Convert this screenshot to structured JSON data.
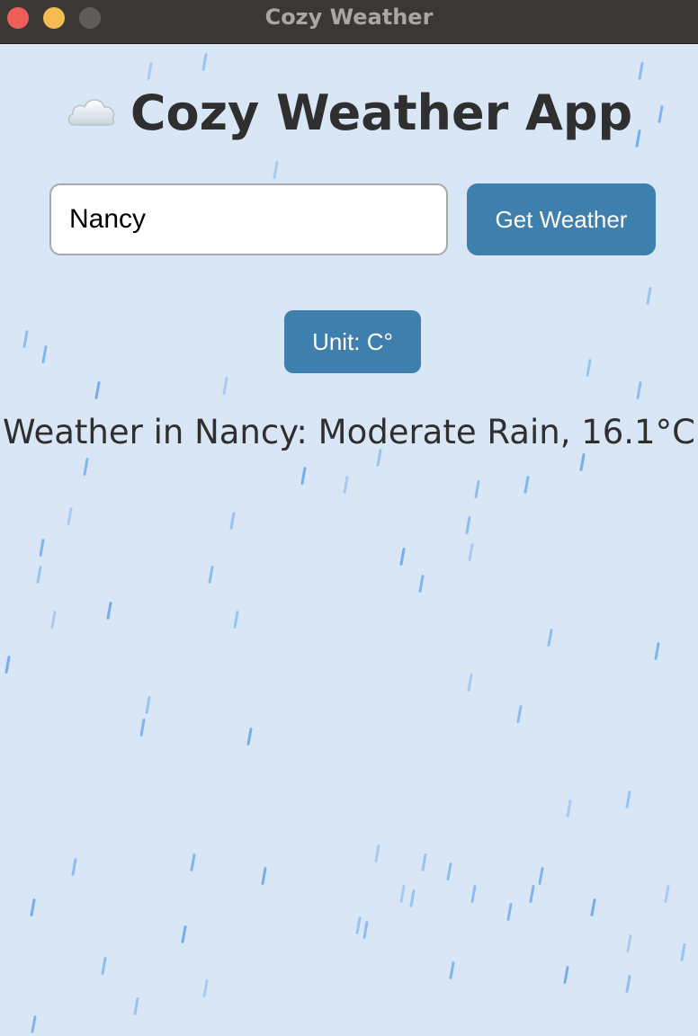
{
  "window": {
    "title": "Cozy Weather"
  },
  "app": {
    "title": "Cozy Weather App",
    "title_icon": "cloud-icon"
  },
  "search": {
    "value": "Nancy",
    "button_label": "Get Weather"
  },
  "unit_toggle": {
    "label": "Unit: C°",
    "unit": "C"
  },
  "result": {
    "text": "Weather in Nancy: Moderate Rain, 16.1°C",
    "city": "Nancy",
    "condition": "Moderate Rain",
    "temperature": 16.1,
    "temperature_unit": "°C"
  },
  "colors": {
    "background": "#d8e6f6",
    "titlebar": "#3b3735",
    "button": "#3f7fae",
    "rain": "#6ca9ea",
    "text": "#2f2f2f"
  }
}
